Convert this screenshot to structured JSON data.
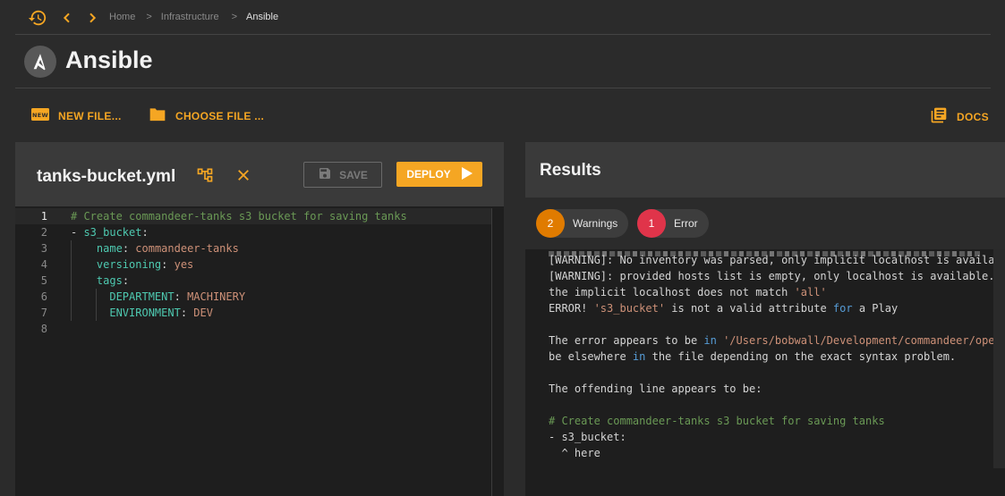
{
  "breadcrumb": [
    "Home",
    ">",
    "Infrastructure",
    ">",
    "Ansible"
  ],
  "header": {
    "title": "Ansible"
  },
  "toolbar": {
    "new_file": "NEW FILE...",
    "choose_file": "CHOOSE FILE ...",
    "docs": "DOCS"
  },
  "editor": {
    "file_name": "tanks-bucket.yml",
    "save_label": "SAVE",
    "deploy_label": "DEPLOY",
    "lines": [
      {
        "num": "1",
        "parts": [
          {
            "t": "# Create commandeer-tanks s3 bucket for saving tanks",
            "c": "cmt"
          }
        ]
      },
      {
        "num": "2",
        "parts": [
          {
            "t": "- ",
            "c": "plain"
          },
          {
            "t": "s3_bucket",
            "c": "key"
          },
          {
            "t": ":",
            "c": "plain"
          }
        ]
      },
      {
        "num": "3",
        "parts": [
          {
            "t": "    ",
            "c": "plain"
          },
          {
            "t": "name",
            "c": "key"
          },
          {
            "t": ": ",
            "c": "plain"
          },
          {
            "t": "commandeer-tanks",
            "c": "str"
          }
        ]
      },
      {
        "num": "4",
        "parts": [
          {
            "t": "    ",
            "c": "plain"
          },
          {
            "t": "versioning",
            "c": "key"
          },
          {
            "t": ": ",
            "c": "plain"
          },
          {
            "t": "yes",
            "c": "str"
          }
        ]
      },
      {
        "num": "5",
        "parts": [
          {
            "t": "    ",
            "c": "plain"
          },
          {
            "t": "tags",
            "c": "key"
          },
          {
            "t": ":",
            "c": "plain"
          }
        ]
      },
      {
        "num": "6",
        "parts": [
          {
            "t": "      ",
            "c": "plain"
          },
          {
            "t": "DEPARTMENT",
            "c": "key"
          },
          {
            "t": ": ",
            "c": "plain"
          },
          {
            "t": "MACHINERY",
            "c": "str"
          }
        ]
      },
      {
        "num": "7",
        "parts": [
          {
            "t": "      ",
            "c": "plain"
          },
          {
            "t": "ENVIRONMENT",
            "c": "key"
          },
          {
            "t": ": ",
            "c": "plain"
          },
          {
            "t": "DEV",
            "c": "str"
          }
        ]
      },
      {
        "num": "8",
        "parts": []
      }
    ]
  },
  "results": {
    "title": "Results",
    "warnings": {
      "count": "2",
      "label": "Warnings"
    },
    "errors": {
      "count": "1",
      "label": "Error"
    },
    "output": [
      [
        {
          "t": "[WARNING]: No inventory was parsed, only implicit localhost is availa",
          "c": ""
        }
      ],
      [
        {
          "t": "[WARNING]: provided hosts list is empty, only localhost is available.",
          "c": ""
        }
      ],
      [
        {
          "t": "the implicit localhost does not match ",
          "c": ""
        },
        {
          "t": "'all'",
          "c": "ostr"
        }
      ],
      [
        {
          "t": "ERROR! ",
          "c": ""
        },
        {
          "t": "'s3_bucket'",
          "c": "ostr"
        },
        {
          "t": " is not a valid attribute ",
          "c": ""
        },
        {
          "t": "for",
          "c": "hl"
        },
        {
          "t": " a Play",
          "c": ""
        }
      ],
      [
        {
          "t": "",
          "c": ""
        }
      ],
      [
        {
          "t": "The error appears to be ",
          "c": ""
        },
        {
          "t": "in",
          "c": "hl"
        },
        {
          "t": " ",
          "c": ""
        },
        {
          "t": "'/Users/bobwall/Development/commandeer/ope",
          "c": "ostr"
        }
      ],
      [
        {
          "t": "be elsewhere ",
          "c": ""
        },
        {
          "t": "in",
          "c": "hl"
        },
        {
          "t": " the file depending on the exact syntax problem.",
          "c": ""
        }
      ],
      [
        {
          "t": "",
          "c": ""
        }
      ],
      [
        {
          "t": "The offending line appears to be:",
          "c": ""
        }
      ],
      [
        {
          "t": "",
          "c": ""
        }
      ],
      [
        {
          "t": "# Create commandeer-tanks s3 bucket for saving tanks",
          "c": "ocmt"
        }
      ],
      [
        {
          "t": "- s3_bucket:",
          "c": ""
        }
      ],
      [
        {
          "t": "  ^ here",
          "c": ""
        }
      ]
    ]
  },
  "colors": {
    "accent": "#f5a623",
    "warning": "#e07b00",
    "error": "#e0344a"
  }
}
